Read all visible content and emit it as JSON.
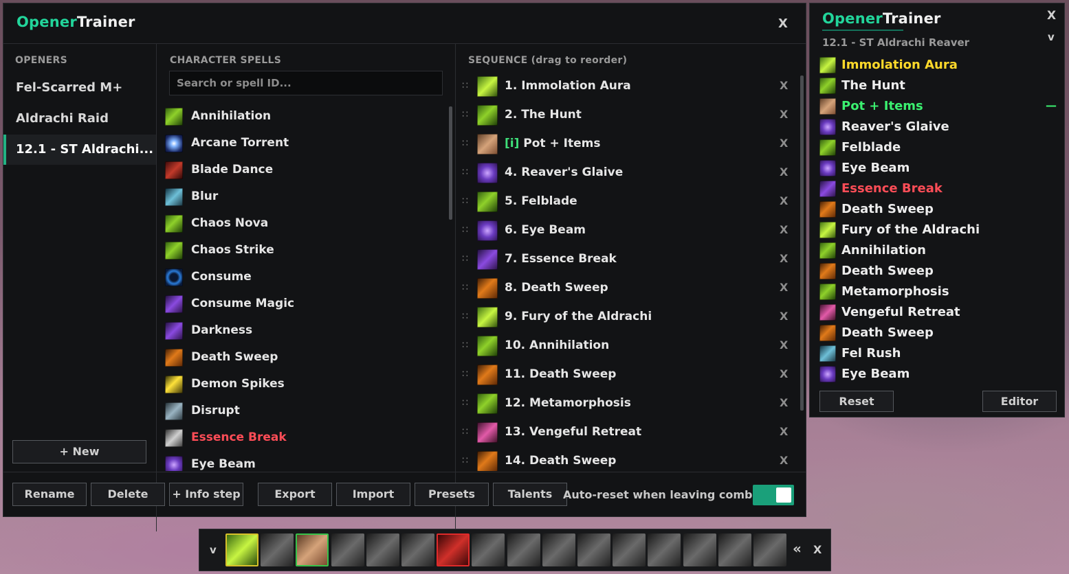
{
  "editor": {
    "brand_opener": "Opener",
    "brand_trainer": "Trainer",
    "close": "X",
    "openers_header": "OPENERS",
    "openers": [
      {
        "label": "Fel-Scarred M+"
      },
      {
        "label": "Aldrachi Raid"
      },
      {
        "label": "12.1 - ST Aldrachi..."
      }
    ],
    "new_button": "+ New",
    "spells_header": "CHARACTER SPELLS",
    "search_placeholder": "Search or spell ID...",
    "spells": [
      {
        "label": "Annihilation",
        "icon": "green"
      },
      {
        "label": "Arcane Torrent",
        "icon": "blue"
      },
      {
        "label": "Blade Dance",
        "icon": "redw"
      },
      {
        "label": "Blur",
        "icon": "teal"
      },
      {
        "label": "Chaos Nova",
        "icon": "green"
      },
      {
        "label": "Chaos Strike",
        "icon": "green"
      },
      {
        "label": "Consume",
        "icon": "ring"
      },
      {
        "label": "Consume Magic",
        "icon": "purple"
      },
      {
        "label": "Darkness",
        "icon": "purple"
      },
      {
        "label": "Death Sweep",
        "icon": "orange"
      },
      {
        "label": "Demon Spikes",
        "icon": "yellow"
      },
      {
        "label": "Disrupt",
        "icon": "steel"
      },
      {
        "label": "Essence Break",
        "icon": "gray",
        "highlight": "red"
      },
      {
        "label": "Eye Beam",
        "icon": "violet"
      }
    ],
    "sequence_header": "SEQUENCE (drag to reorder)",
    "sequence": [
      {
        "label": "1. Immolation Aura",
        "icon": "lime"
      },
      {
        "label": "2. The Hunt",
        "icon": "green"
      },
      {
        "tag": "[i]",
        "label": " Pot + Items",
        "icon": "scroll"
      },
      {
        "label": "4. Reaver's Glaive",
        "icon": "violet"
      },
      {
        "label": "5. Felblade",
        "icon": "green"
      },
      {
        "label": "6. Eye Beam",
        "icon": "violet"
      },
      {
        "label": "7. Essence Break",
        "icon": "purple"
      },
      {
        "label": "8. Death Sweep",
        "icon": "orange"
      },
      {
        "label": "9. Fury of the Aldrachi",
        "icon": "lime"
      },
      {
        "label": "10. Annihilation",
        "icon": "green"
      },
      {
        "label": "11. Death Sweep",
        "icon": "orange"
      },
      {
        "label": "12. Metamorphosis",
        "icon": "green"
      },
      {
        "label": "13. Vengeful Retreat",
        "icon": "pink"
      },
      {
        "label": "14. Death Sweep",
        "icon": "orange"
      }
    ],
    "remove_label": "X",
    "footer": {
      "rename": "Rename",
      "delete": "Delete",
      "info_step": "+ Info step",
      "export": "Export",
      "import": "Import",
      "presets": "Presets",
      "talents": "Talents",
      "auto_reset_label": "Auto-reset when leaving combat",
      "auto_reset_enabled": true
    }
  },
  "tracker": {
    "brand_opener": "Opener",
    "brand_trainer": "Trainer",
    "close": "X",
    "collapse": "v",
    "subtitle": "12.1 - ST Aldrachi Reaver",
    "items": [
      {
        "label": "Immolation Aura",
        "icon": "lime",
        "state": "current"
      },
      {
        "label": "The Hunt",
        "icon": "green"
      },
      {
        "label": "Pot + Items",
        "icon": "scroll",
        "state": "info"
      },
      {
        "label": "Reaver's Glaive",
        "icon": "violet"
      },
      {
        "label": "Felblade",
        "icon": "green"
      },
      {
        "label": "Eye Beam",
        "icon": "violet"
      },
      {
        "label": "Essence Break",
        "icon": "purple",
        "state": "error"
      },
      {
        "label": "Death Sweep",
        "icon": "orange"
      },
      {
        "label": "Fury of the Aldrachi",
        "icon": "lime"
      },
      {
        "label": "Annihilation",
        "icon": "green"
      },
      {
        "label": "Death Sweep",
        "icon": "orange"
      },
      {
        "label": "Metamorphosis",
        "icon": "green"
      },
      {
        "label": "Vengeful Retreat",
        "icon": "pink"
      },
      {
        "label": "Death Sweep",
        "icon": "orange"
      },
      {
        "label": "Fel Rush",
        "icon": "teal"
      },
      {
        "label": "Eye Beam",
        "icon": "violet"
      }
    ],
    "info_marker": "—",
    "reset": "Reset",
    "editor": "Editor"
  },
  "hotbar": {
    "collapse": "v",
    "expand": "«",
    "close": "X",
    "slots": [
      "lime",
      "dark",
      "scroll",
      "dark",
      "dark",
      "dark",
      "redslot",
      "dark",
      "dark",
      "dark",
      "dark",
      "dark",
      "dark",
      "dark",
      "dark",
      "dark"
    ]
  },
  "colors": {
    "accent": "#22d59b",
    "error": "#ff4d57",
    "current": "#ffd92a",
    "info": "#3bf070"
  }
}
